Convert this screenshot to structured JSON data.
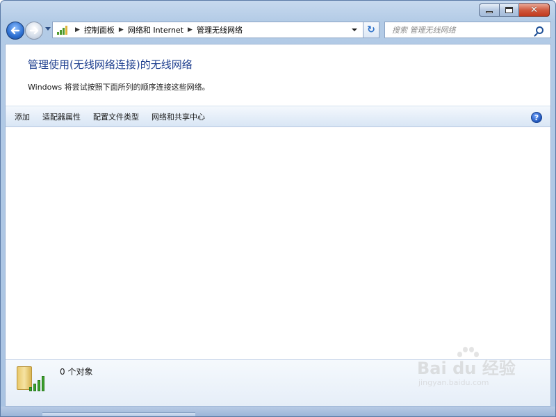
{
  "window": {
    "minimize_label": "",
    "maximize_label": "",
    "close_label": "✕"
  },
  "nav": {
    "back_icon": "arrow-left-icon",
    "forward_icon": "arrow-right-icon"
  },
  "address": {
    "crumbs": [
      "控制面板",
      "网络和 Internet",
      "管理无线网络"
    ],
    "separator": "▶"
  },
  "refresh_glyph": "↻",
  "search": {
    "placeholder": "搜索 管理无线网络"
  },
  "header": {
    "title": "管理使用(无线网络连接)的无线网络",
    "description": "Windows 将尝试按照下面所列的顺序连接这些网络。"
  },
  "toolbar": {
    "items": [
      "添加",
      "适配器属性",
      "配置文件类型",
      "网络和共享中心"
    ],
    "help_label": "?"
  },
  "details": {
    "item_count": "0 个对象"
  },
  "watermark": {
    "line1": "Bai du 经验",
    "line2": "jingyan.baidu.com"
  },
  "colors": {
    "title": "#1e3f8f",
    "window_frame": "#b3cbe6",
    "close_button": "#c23a1e"
  }
}
